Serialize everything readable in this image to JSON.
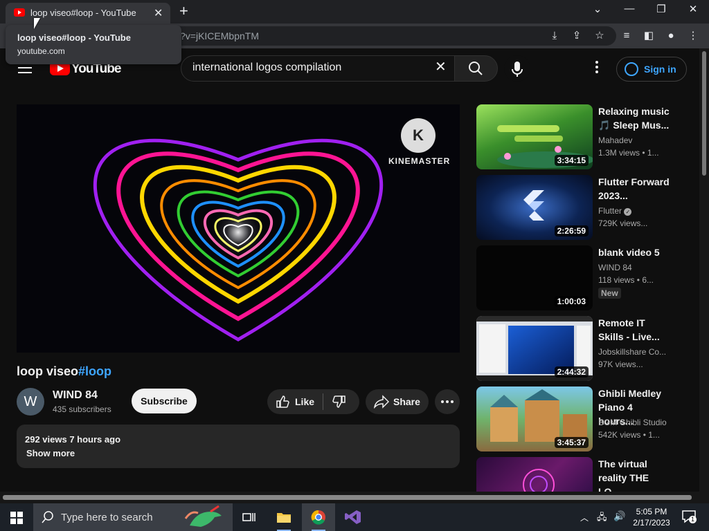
{
  "browser": {
    "tab_title": "loop viseo#loop - YouTube",
    "url_visible": "?v=jKICEMbpnTM",
    "tooltip": {
      "title": "loop viseo#loop - YouTube",
      "domain": "youtube.com"
    }
  },
  "header": {
    "logo_text": "YouTube",
    "search_value": "international logos compilation",
    "signin_label": "Sign in"
  },
  "video": {
    "title": "loop viseo",
    "hashtag": "#loop",
    "channel_name": "WIND 84",
    "channel_initial": "W",
    "subscribers": "435 subscribers",
    "subscribe_label": "Subscribe",
    "like_label": "Like",
    "share_label": "Share",
    "stats": "292 views  7 hours ago",
    "show_more": "Show more",
    "watermark": "KINEMASTER",
    "watermark_logo": "K"
  },
  "recommendations": [
    {
      "title": "Relaxing music 🎵 Sleep Mus...",
      "channel": "Mahadev",
      "meta": "1.3M views  • 1...",
      "duration": "3:34:15",
      "verified": false
    },
    {
      "title": "Flutter Forward 2023...",
      "channel": "Flutter",
      "meta": "729K views...",
      "duration": "2:26:59",
      "verified": true
    },
    {
      "title": "blank video 5",
      "channel": "WIND 84",
      "meta": "118 views  • 6...",
      "duration": "1:00:03",
      "badge": "New"
    },
    {
      "title": "Remote IT Skills - Live...",
      "channel": "Jobskillshare Co...",
      "meta": "97K views...",
      "duration": "2:44:32"
    },
    {
      "title": "Ghibli Medley Piano 4 hours...",
      "channel": "BGM Ghibli Studio",
      "meta": "542K views  • 1...",
      "duration": "3:45:37"
    },
    {
      "title": "The virtual reality THE LO...",
      "channel": "",
      "meta": "",
      "duration": ""
    }
  ],
  "taskbar": {
    "search_placeholder": "Type here to search",
    "time": "5:05 PM",
    "date": "2/17/2023",
    "notifications": "1"
  },
  "colors": {
    "accent": "#3ea6ff",
    "brand": "#ff0000",
    "background": "#0f0f0f"
  }
}
